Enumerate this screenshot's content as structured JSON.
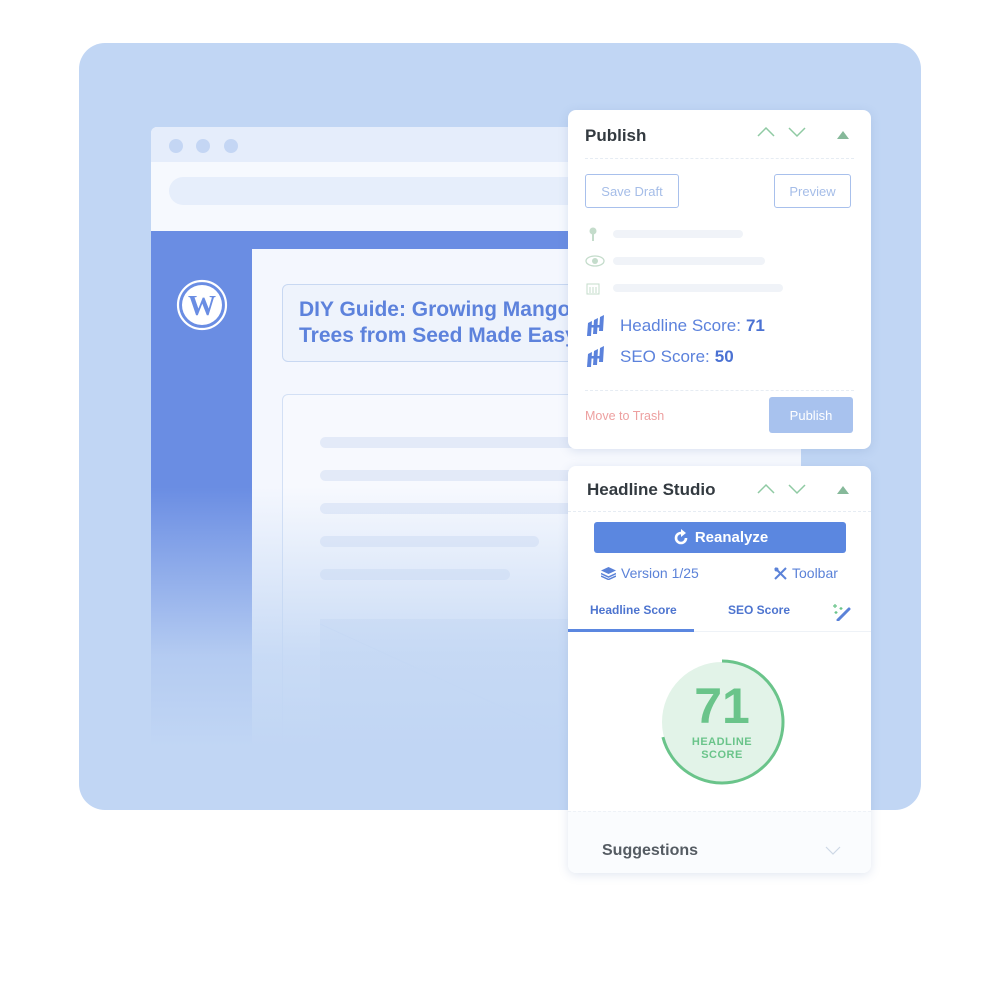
{
  "colors": {
    "backdrop": "#c1d6f4",
    "wp_blue": "#6a8de3",
    "primary": "#5b87e0",
    "score_green": "#6ac48a",
    "trash_red": "#eda0a0"
  },
  "browser": {
    "window_dots": 3,
    "logo_icon": "wordpress-logo-icon",
    "post_title": "DIY Guide: Growing Mango Trees from Seed Made Easy",
    "post_title_line1": "DIY Guide: Growing Mango",
    "post_title_line2": "Trees from Seed Made Easy"
  },
  "publish_panel": {
    "title": "Publish",
    "header_icons": [
      "chevron-up-icon",
      "chevron-down-icon",
      "triangle-toggle-icon"
    ],
    "save_draft_label": "Save Draft",
    "preview_label": "Preview",
    "meta_icons": [
      "key-icon",
      "eye-icon",
      "calendar-icon"
    ],
    "headline_score_label": "Headline Score:",
    "headline_score_value": "71",
    "seo_score_label": "SEO Score:",
    "seo_score_value": "50",
    "move_to_trash_label": "Move to Trash",
    "publish_label": "Publish"
  },
  "headline_studio": {
    "title": "Headline Studio",
    "reanalyze_label": "Reanalyze",
    "version_label": "Version 1/25",
    "toolbar_label": "Toolbar",
    "tabs": [
      {
        "label": "Headline Score",
        "active": true
      },
      {
        "label": "SEO Score",
        "active": false
      }
    ],
    "score": {
      "value": "71",
      "max": 100,
      "label_line1": "HEADLINE",
      "label_line2": "SCORE"
    },
    "suggestions_label": "Suggestions"
  }
}
